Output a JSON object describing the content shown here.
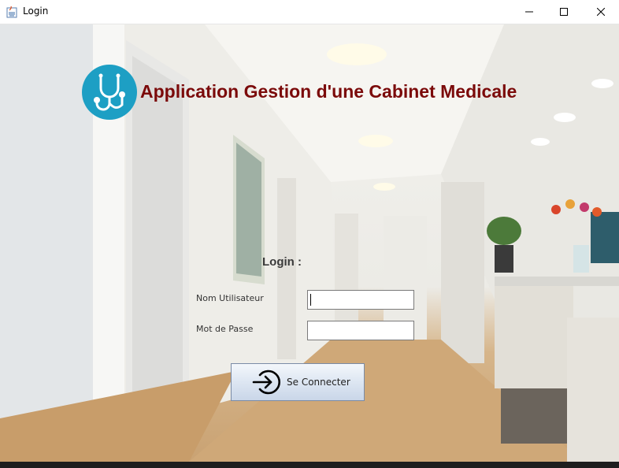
{
  "window": {
    "title": "Login"
  },
  "header": {
    "app_title": "Application Gestion d'une Cabinet Medicale",
    "logo_icon": "stethoscope-icon",
    "logo_color": "#1d9fc4",
    "title_color": "#7b0a0a"
  },
  "form": {
    "heading": "Login :",
    "username_label": "Nom Utilisateur",
    "username_value": "",
    "password_label": "Mot de Passe",
    "password_value": "",
    "submit_label": "Se Connecter",
    "submit_icon": "login-arrow-icon"
  }
}
